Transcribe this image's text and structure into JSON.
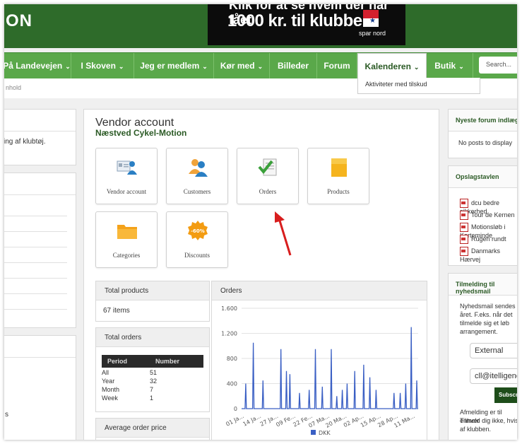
{
  "header": {
    "logo": "ON",
    "banner_top": "Klik for at se hvem der har fået",
    "banner_main": "1000 kr. til klubben",
    "sponsor": "spar nord"
  },
  "nav": {
    "items": [
      {
        "label": "På Landevejen"
      },
      {
        "label": "I Skoven"
      },
      {
        "label": "Jeg er medlem"
      },
      {
        "label": "Kør med"
      },
      {
        "label": "Billeder"
      },
      {
        "label": "Forum"
      },
      {
        "label": "Kalenderen"
      },
      {
        "label": "Butik"
      }
    ],
    "dropdown_item": "Aktiviteter med tilskud",
    "search_placeholder": "Search..."
  },
  "breadcrumb": "nhold",
  "left": {
    "text": "ing af klubtøj.",
    "bottom_text": "s"
  },
  "vendor": {
    "title": "Vendor account",
    "store": "Næstved Cykel-Motion",
    "tiles": [
      {
        "label": "Vendor account",
        "icon": "vendor-card-icon"
      },
      {
        "label": "Customers",
        "icon": "customers-icon"
      },
      {
        "label": "Orders",
        "icon": "orders-checkmark-icon"
      },
      {
        "label": "Products",
        "icon": "products-box-icon"
      },
      {
        "label": "Categories",
        "icon": "categories-folder-icon"
      },
      {
        "label": "Discounts",
        "icon": "discount-badge-icon"
      }
    ],
    "discount_badge": "-60%"
  },
  "stats": {
    "total_products_label": "Total products",
    "total_products_value": "67 items",
    "total_orders_label": "Total orders",
    "period_header": "Period",
    "number_header": "Number",
    "rows": [
      {
        "period": "All",
        "number": "51"
      },
      {
        "period": "Year",
        "number": "32"
      },
      {
        "period": "Month",
        "number": "7"
      },
      {
        "period": "Week",
        "number": "1"
      }
    ],
    "avg_label": "Average order price"
  },
  "chart_data": {
    "type": "line",
    "title": "Orders",
    "yticks": [
      "0",
      "400",
      "800",
      "1.200",
      "1.600"
    ],
    "ylim": [
      0,
      1600
    ],
    "xticks": [
      "01 Ja...",
      "14 Ja...",
      "27 Ja...",
      "09 Fe...",
      "22 Fe...",
      "07 Ma...",
      "20 Ma...",
      "02 Ap...",
      "15 Ap...",
      "28 Ap...",
      "11 Ma..."
    ],
    "legend": "DKK",
    "series": [
      {
        "name": "DKK",
        "color": "#3a5fc4",
        "values": [
          0,
          0,
          0,
          0,
          0,
          0,
          400,
          0,
          0,
          0,
          0,
          0,
          0,
          0,
          0,
          0,
          0,
          1050,
          0,
          0,
          0,
          0,
          0,
          0,
          0,
          0,
          0,
          0,
          0,
          0,
          0,
          450,
          0,
          0,
          0,
          0,
          0,
          0,
          0,
          0,
          0,
          0,
          0,
          0,
          0,
          0,
          0,
          0,
          0,
          0,
          0,
          0,
          0,
          0,
          0,
          0,
          0,
          950,
          0,
          0,
          0,
          0,
          0,
          0,
          0,
          600,
          0,
          0,
          0,
          0,
          550,
          0,
          0,
          0,
          0,
          0,
          0,
          0,
          0,
          0,
          0,
          0,
          0,
          0,
          250,
          0,
          0,
          0,
          0,
          0,
          0,
          0,
          0,
          0,
          0,
          0,
          0,
          0,
          300,
          0,
          0,
          0,
          0,
          0,
          0,
          0,
          0,
          950,
          0,
          0,
          0,
          0,
          0,
          0,
          0,
          0,
          0,
          350,
          0,
          0,
          0,
          0,
          0,
          0,
          0,
          0,
          0,
          0,
          0,
          0,
          950,
          0,
          0,
          0,
          0,
          0,
          0,
          0,
          200,
          0,
          0,
          0,
          0,
          0,
          0,
          0,
          300,
          0,
          0,
          0,
          0,
          0,
          0,
          400,
          0,
          0,
          0,
          0,
          0,
          0,
          0,
          0,
          0,
          0,
          600,
          0,
          0,
          0,
          0,
          0,
          0,
          0,
          0,
          0,
          0,
          0,
          0,
          700,
          0,
          0,
          0,
          0,
          0,
          0,
          0,
          0,
          500,
          0,
          0,
          0,
          0,
          0,
          0,
          0,
          0,
          300,
          0,
          0,
          0,
          0,
          0,
          0,
          0,
          0,
          0,
          0,
          0,
          0,
          0,
          0,
          0,
          0,
          0,
          0,
          0,
          0,
          0,
          0,
          0,
          0,
          0,
          250,
          0,
          0,
          0,
          0,
          0,
          0,
          0,
          0,
          250,
          0,
          0,
          0,
          0,
          0,
          0,
          0,
          400,
          0,
          0,
          0,
          0,
          0,
          0,
          0,
          1300,
          0,
          0,
          0,
          0,
          0,
          0,
          0,
          450,
          0,
          0
        ]
      }
    ]
  },
  "right": {
    "forum_title": "Nyeste forum indlæg",
    "forum_empty": "No posts to display",
    "board_title": "Opslagstavlen",
    "board_items": [
      "dcu bedre sikkerhed",
      "Tour de Kernen",
      "Motionsløb i Kerteminde",
      "Rügen rundt",
      "Danmarks Hærvej"
    ],
    "newsletter_title": "Tilmelding til nyhedsmail",
    "newsletter_text": [
      "Nyhedsmail sendes",
      "året. F.eks. når det",
      "tilmelde sig et løb",
      "arrangement."
    ],
    "select_value": "External",
    "email_value": "cll@itelligence",
    "submit_label": "Subscribe",
    "footer_text": [
      "Afmelding er til enhver",
      "Tilmeld dig ikke, hvis",
      "af klubben."
    ]
  }
}
